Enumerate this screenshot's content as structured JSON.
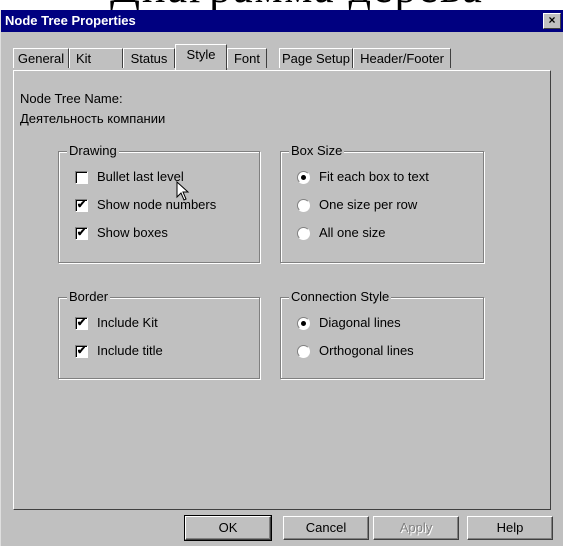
{
  "page_heading": "Диаграмма дерева",
  "window": {
    "title": "Node Tree Properties",
    "close_label": "×"
  },
  "tabs": [
    {
      "label": "General"
    },
    {
      "label": "Kit"
    },
    {
      "label": "Status"
    },
    {
      "label": "Style"
    },
    {
      "label": "Font"
    },
    {
      "label": "Page Setup"
    },
    {
      "label": "Header/Footer"
    }
  ],
  "active_tab": "Style",
  "node_tree": {
    "name_label": "Node Tree Name:",
    "name_value": "Деятельность компании"
  },
  "drawing": {
    "title": "Drawing",
    "options": [
      {
        "label": "Bullet last level",
        "checked": false
      },
      {
        "label": "Show node numbers",
        "checked": true
      },
      {
        "label": "Show boxes",
        "checked": true
      }
    ]
  },
  "box_size": {
    "title": "Box Size",
    "options": [
      {
        "label": "Fit each box to text",
        "selected": true
      },
      {
        "label": "One size per row",
        "selected": false
      },
      {
        "label": "All one size",
        "selected": false
      }
    ]
  },
  "border": {
    "title": "Border",
    "options": [
      {
        "label": "Include Kit",
        "checked": true
      },
      {
        "label": "Include title",
        "checked": true
      }
    ]
  },
  "connection_style": {
    "title": "Connection Style",
    "options": [
      {
        "label": "Diagonal lines",
        "selected": true
      },
      {
        "label": "Orthogonal lines",
        "selected": false
      }
    ]
  },
  "buttons": {
    "ok": "OK",
    "cancel": "Cancel",
    "apply": "Apply",
    "help": "Help"
  },
  "check_mark": "✔"
}
